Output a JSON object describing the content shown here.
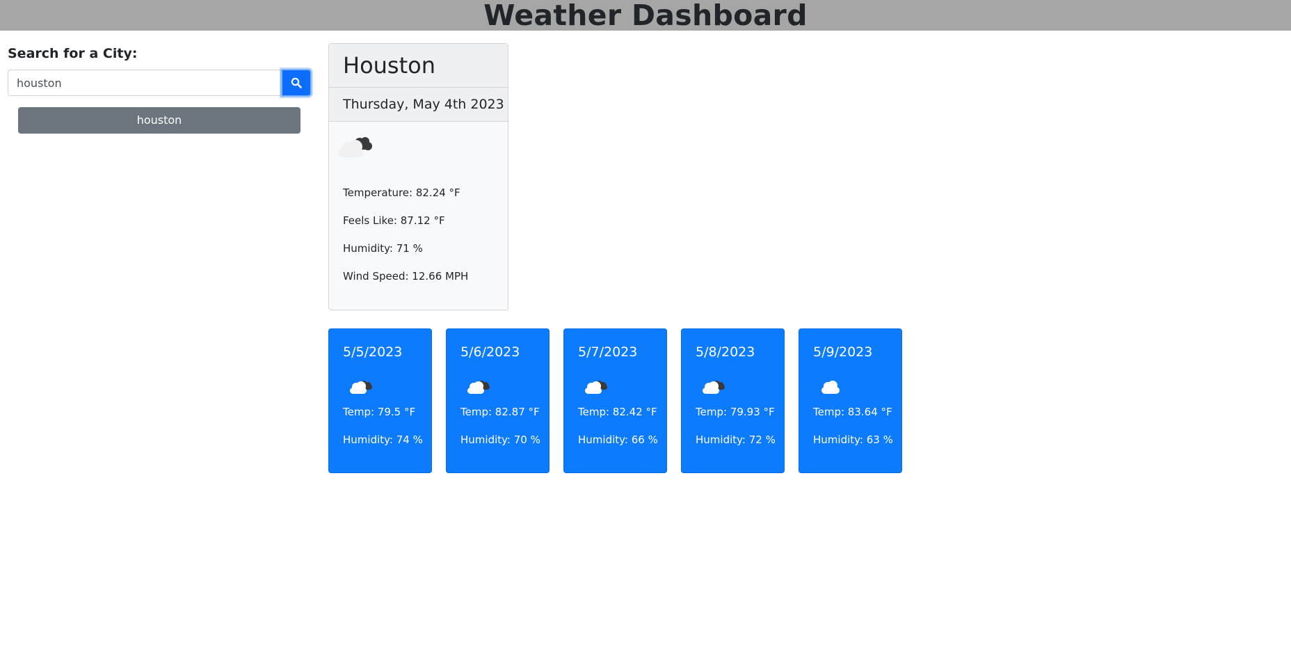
{
  "header": {
    "title": "Weather Dashboard"
  },
  "search": {
    "label": "Search for a City:",
    "value": "houston",
    "button_icon": "search-icon",
    "history": [
      "houston"
    ]
  },
  "current": {
    "city": "Houston",
    "date": "Thursday, May 4th 2023",
    "icon": "broken-clouds-icon",
    "temperature": "Temperature: 82.24 °F",
    "feels_like": "Feels Like: 87.12 °F",
    "humidity": "Humidity: 71 %",
    "wind_speed": "Wind Speed: 12.66 MPH"
  },
  "forecast": [
    {
      "date": "5/5/2023",
      "icon": "broken-clouds-icon",
      "temp": "Temp: 79.5 °F",
      "humidity": "Humidity: 74 %"
    },
    {
      "date": "5/6/2023",
      "icon": "broken-clouds-icon",
      "temp": "Temp: 82.87 °F",
      "humidity": "Humidity: 70 %"
    },
    {
      "date": "5/7/2023",
      "icon": "broken-clouds-icon",
      "temp": "Temp: 82.42 °F",
      "humidity": "Humidity: 66 %"
    },
    {
      "date": "5/8/2023",
      "icon": "broken-clouds-icon",
      "temp": "Temp: 79.93 °F",
      "humidity": "Humidity: 72 %"
    },
    {
      "date": "5/9/2023",
      "icon": "cloud-icon",
      "temp": "Temp: 83.64 °F",
      "humidity": "Humidity: 63 %"
    }
  ],
  "colors": {
    "header_bg": "#a6a6a6",
    "primary": "#0d6efd",
    "forecast_bg": "#0d7bfd",
    "history_button": "#6c757d"
  }
}
